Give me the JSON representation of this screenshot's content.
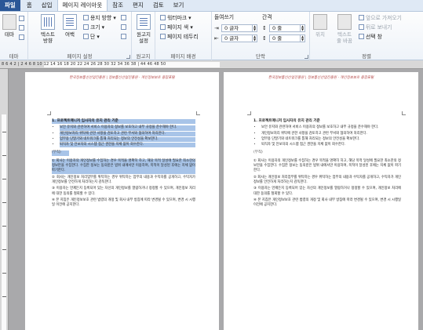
{
  "tabs": [
    {
      "label": "파일",
      "kind": "file"
    },
    {
      "label": "홈",
      "kind": "normal"
    },
    {
      "label": "삽입",
      "kind": "normal"
    },
    {
      "label": "페이지 레이아웃",
      "kind": "active"
    },
    {
      "label": "참조",
      "kind": "normal"
    },
    {
      "label": "편지",
      "kind": "normal"
    },
    {
      "label": "검토",
      "kind": "normal"
    },
    {
      "label": "보기",
      "kind": "normal"
    }
  ],
  "ribbon": {
    "theme": {
      "btn1": "테마",
      "label": "테마"
    },
    "page_setup": {
      "text_direction": "텍스트\n방향",
      "margins": "여백",
      "orientation": "용지 방향",
      "size": "크기",
      "columns": "단",
      "label": "페이지 설정"
    },
    "manuscript": {
      "btn": "원고지\n설정",
      "label": "원고지"
    },
    "background": {
      "watermark": "워터마크",
      "page_color": "페이지 색",
      "page_borders": "페이지 테두리",
      "label": "페이지 배경"
    },
    "paragraph": {
      "indent_label": "들여쓰기",
      "spacing_label": "간격",
      "indent_left": "0 글자",
      "indent_right": "0 글자",
      "spacing_before": "0 줄",
      "spacing_after": "0 줄",
      "label": "단락"
    },
    "arrange": {
      "position": "위치",
      "wrap": "텍스트\n줄 바꿈",
      "bring_forward": "앞으로 가져오기",
      "send_backward": "뒤로 보내기",
      "selection_pane": "선택 창",
      "label": "정렬"
    }
  },
  "ruler": {
    "numbers": "8 6 4 2 | 2 4 6 8 10 12 14 16 18 20 22 24 26 28 30 32 34 36 38 | 44 46 48 50"
  },
  "doc": {
    "header_text": "한국정보통신산업진흥원 | 정보통신산업진흥원 · 개인정보보호 종합포털",
    "heading": "1. 프로젝트매니저 입사자의 유지 관리 기준",
    "bullets": [
      "보안 유지와 관련하여 서비스 이용자의 정보를 보호하고 내부 규정을 준수해야 한다.",
      "개인정보처리 위탁에 관한 사항을 검토하고 관련 부서와 협의하여 처리한다.",
      "업무용 단말기와 네트워크를 통해 처리되는 정보의 안전성을 확보한다.",
      "퇴직자 및 전보자의 시스템 접근 권한을 지체 없이 회수한다."
    ],
    "para1": "① 회사는 이용자의 개인정보를 수집하는 경우 목적을 명확히 하고, 해당 목적 달성에 필요한 최소한의 정보만을 수집한다. 수집한 정보는 동의받은 범위 내에서만 이용하며, 목적이 달성된 후에는 지체 없이 파기한다.",
    "para2": "② 회사는 개인정보 처리업무를 위탁하는 경우 위탁하는 업무의 내용과 수탁자를 공개하고, 수탁자가 개인정보를 안전하게 처리하는지 감독한다.",
    "para3": "③ 이용자는 언제든지 등록되어 있는 자신의 개인정보를 열람하거나 정정할 수 있으며, 개인정보 처리에 대한 동의를 철회할 수 있다.",
    "para4": "④ 본 지침은 개인정보보호 관련 법령의 개정 및 회사 내부 방침에 따라 변경될 수 있으며, 변경 시 시행일 이전에 공지한다.",
    "separator": "(부칙)"
  }
}
